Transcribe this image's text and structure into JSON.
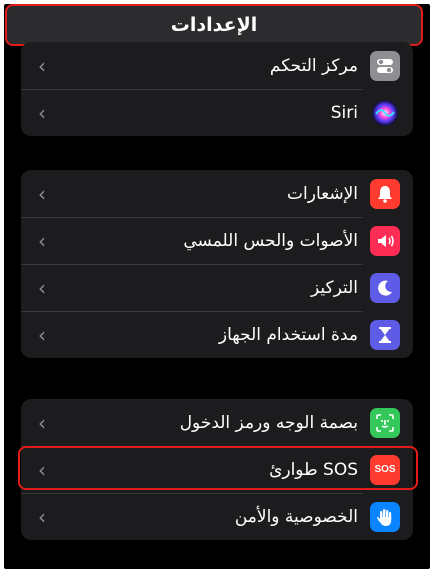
{
  "header": {
    "title": "الإعدادات"
  },
  "groups": [
    {
      "items": [
        {
          "label": "مركز التحكم",
          "icon": "control-center-icon",
          "color": "#8e8e93"
        },
        {
          "label": "Siri",
          "icon": "siri-icon",
          "color": "#1c1c1e"
        }
      ]
    },
    {
      "items": [
        {
          "label": "الإشعارات",
          "icon": "notifications-icon",
          "color": "#ff3b30"
        },
        {
          "label": "الأصوات والحس اللمسي",
          "icon": "sounds-icon",
          "color": "#ff2d55"
        },
        {
          "label": "التركيز",
          "icon": "focus-moon-icon",
          "color": "#5e5ce6"
        },
        {
          "label": "مدة استخدام الجهاز",
          "icon": "screen-time-icon",
          "color": "#5e5ce6"
        }
      ]
    },
    {
      "items": [
        {
          "label": "بصمة الوجه ورمز الدخول",
          "icon": "face-id-icon",
          "color": "#34c759"
        },
        {
          "label": "طوارئ SOS",
          "icon": "sos-icon",
          "color": "#ff3b30",
          "icon_text": "SOS"
        },
        {
          "label": "الخصوصية والأمن",
          "icon": "privacy-hand-icon",
          "color": "#0a84ff"
        }
      ]
    }
  ],
  "chevron": "‹",
  "highlight_color": "#e21b1b"
}
